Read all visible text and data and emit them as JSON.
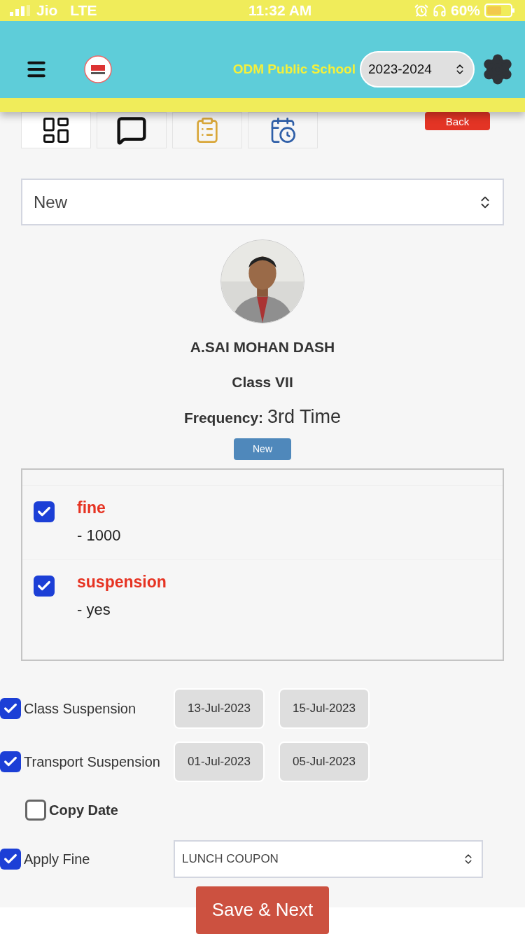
{
  "status_bar": {
    "carrier": "Jio",
    "network": "LTE",
    "time": "11:32 AM",
    "battery": "60%"
  },
  "header": {
    "school_name": "ODM Public School",
    "session": "2023-2024"
  },
  "tabs": [
    {
      "kind": "dashboard",
      "selected": true
    },
    {
      "kind": "message",
      "selected": false
    },
    {
      "kind": "clipboard",
      "selected": false
    },
    {
      "kind": "calendar",
      "selected": false
    }
  ],
  "back_button": "Back",
  "status_select": "New",
  "student": {
    "name": "A.SAI MOHAN DASH",
    "class": "Class VII",
    "frequency_label": "Frequency:",
    "frequency": "3rd Time",
    "badge": "New"
  },
  "actions": [
    {
      "title": "fine",
      "detail": "- 1000",
      "checked": true
    },
    {
      "title": "suspension",
      "detail": "- yes",
      "checked": true
    }
  ],
  "form_rows": [
    {
      "kind": "dates",
      "label": "Class Suspension",
      "checked": true,
      "from": "13-Jul-2023",
      "to": "15-Jul-2023"
    },
    {
      "kind": "dates",
      "label": "Transport Suspension",
      "checked": true,
      "from": "01-Jul-2023",
      "to": "05-Jul-2023"
    },
    {
      "kind": "copy",
      "label": "Copy Date",
      "checked": false
    },
    {
      "kind": "select",
      "label": "Apply Fine",
      "checked": true,
      "value": "LUNCH COUPON"
    }
  ],
  "save_button": "Save & Next"
}
